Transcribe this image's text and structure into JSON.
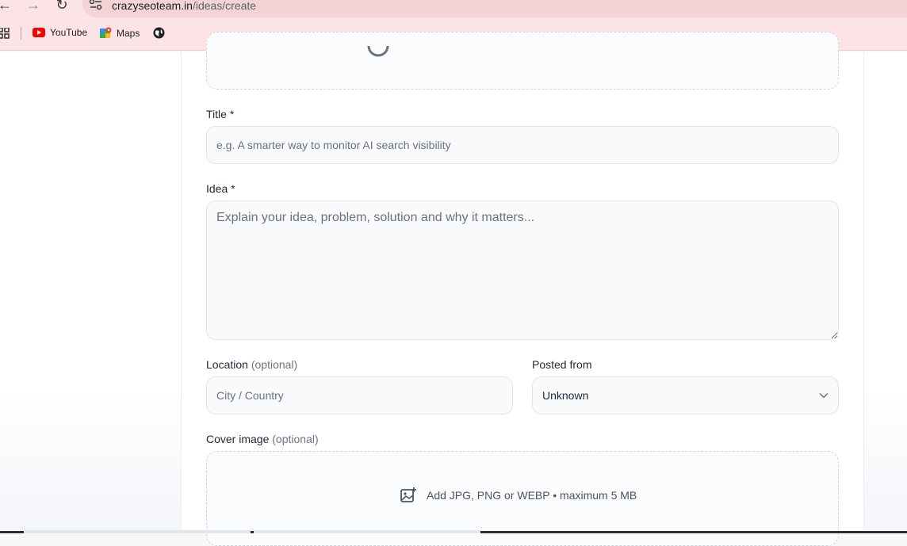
{
  "browser": {
    "url_host": "crazyseoteam.in",
    "url_path": "/ideas/create",
    "bookmarks": [
      {
        "label": "YouTube",
        "icon": "youtube-icon"
      },
      {
        "label": "Maps",
        "icon": "maps-icon"
      },
      {
        "label": "",
        "icon": "globe-icon"
      }
    ]
  },
  "form": {
    "title": {
      "label": "Title *",
      "placeholder": "e.g. A smarter way to monitor AI search visibility"
    },
    "idea": {
      "label": "Idea *",
      "placeholder": "Explain your idea, problem, solution and why it matters..."
    },
    "location": {
      "label": "Location",
      "optional": "(optional)",
      "placeholder": "City / Country"
    },
    "posted_from": {
      "label": "Posted from",
      "value": "Unknown"
    },
    "cover": {
      "label": "Cover image",
      "optional": "(optional)",
      "hint": "Add JPG, PNG or WEBP • maximum 5 MB"
    }
  },
  "colors": {
    "chrome": "#fce4e6",
    "field_bg": "#f8fafc",
    "field_border": "#dfe4ea",
    "youtube_red": "#ff0000"
  }
}
